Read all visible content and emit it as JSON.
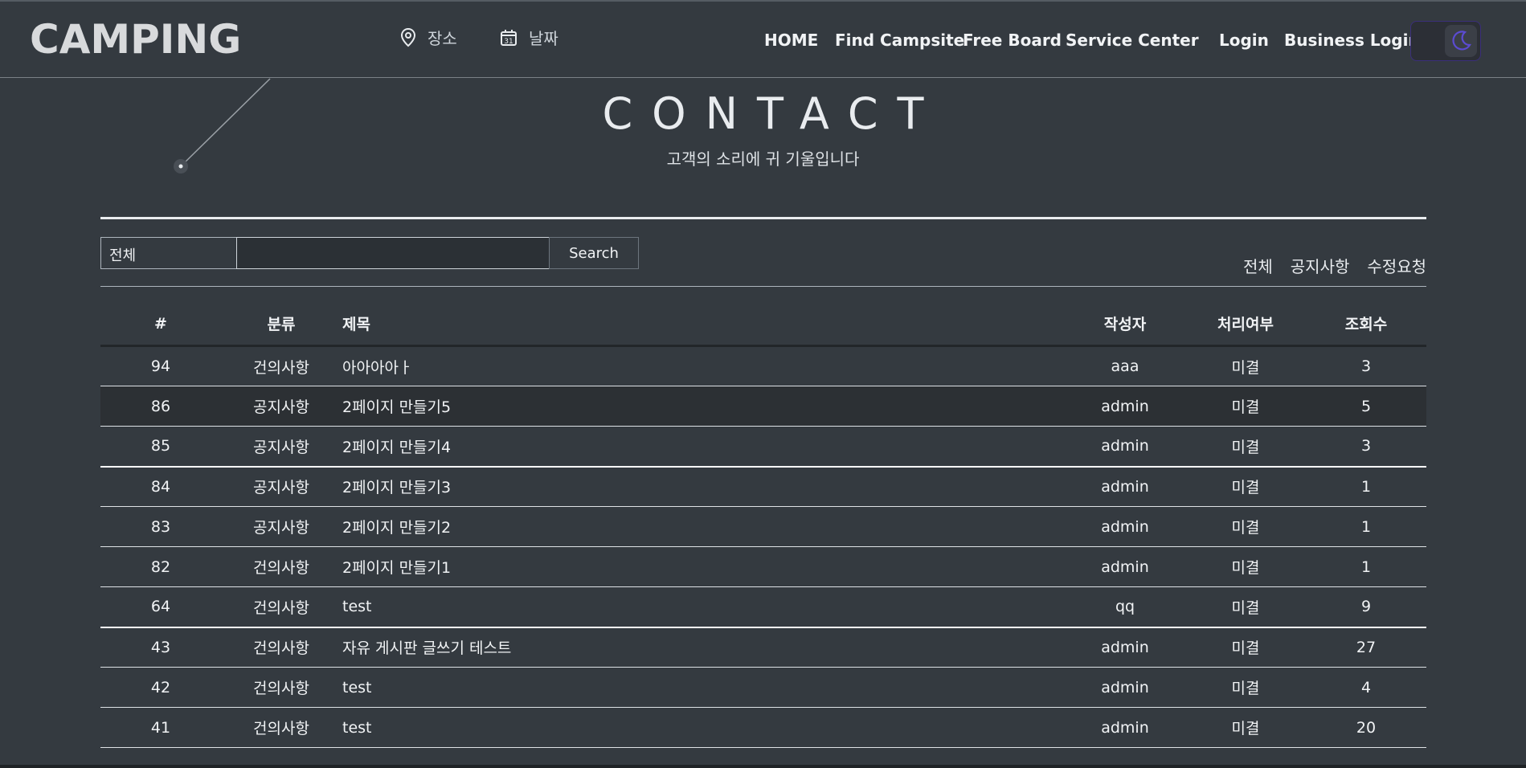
{
  "header": {
    "logo": "CAMPING",
    "search_place": "장소",
    "search_date": "날짜",
    "nav": [
      "HOME",
      "Find Campsite",
      "Free Board",
      "Service Center"
    ],
    "login": "Login",
    "business_login": "Business Login"
  },
  "hero": {
    "title": "CONTACT",
    "subtitle": "고객의 소리에 귀 기울입니다"
  },
  "search": {
    "category_selected": "전체",
    "query_value": "",
    "button_label": "Search"
  },
  "filters": [
    "전체",
    "공지사항",
    "수정요청"
  ],
  "table": {
    "headers": [
      "#",
      "분류",
      "제목",
      "작성자",
      "처리여부",
      "조회수"
    ],
    "rows": [
      {
        "num": "94",
        "category": "건의사항",
        "title": "아아아아ㅏ",
        "author": "aaa",
        "status": "미결",
        "views": "3"
      },
      {
        "num": "86",
        "category": "공지사항",
        "title": "2페이지 만들기5",
        "author": "admin",
        "status": "미결",
        "views": "5"
      },
      {
        "num": "85",
        "category": "공지사항",
        "title": "2페이지 만들기4",
        "author": "admin",
        "status": "미결",
        "views": "3"
      },
      {
        "num": "84",
        "category": "공지사항",
        "title": "2페이지 만들기3",
        "author": "admin",
        "status": "미결",
        "views": "1"
      },
      {
        "num": "83",
        "category": "공지사항",
        "title": "2페이지 만들기2",
        "author": "admin",
        "status": "미결",
        "views": "1"
      },
      {
        "num": "82",
        "category": "건의사항",
        "title": "2페이지 만들기1",
        "author": "admin",
        "status": "미결",
        "views": "1"
      },
      {
        "num": "64",
        "category": "건의사항",
        "title": "test",
        "author": "qq",
        "status": "미결",
        "views": "9"
      },
      {
        "num": "43",
        "category": "건의사항",
        "title": "자유 게시판 글쓰기 테스트",
        "author": "admin",
        "status": "미결",
        "views": "27"
      },
      {
        "num": "42",
        "category": "건의사항",
        "title": "test",
        "author": "admin",
        "status": "미결",
        "views": "4"
      },
      {
        "num": "41",
        "category": "건의사항",
        "title": "test",
        "author": "admin",
        "status": "미결",
        "views": "20"
      }
    ]
  },
  "icons": {
    "place": "map-pin-icon",
    "date": "calendar-icon",
    "theme": "moon-icon"
  },
  "colors": {
    "background": "#343a40",
    "toggle_accent": "#5b4bd1"
  }
}
